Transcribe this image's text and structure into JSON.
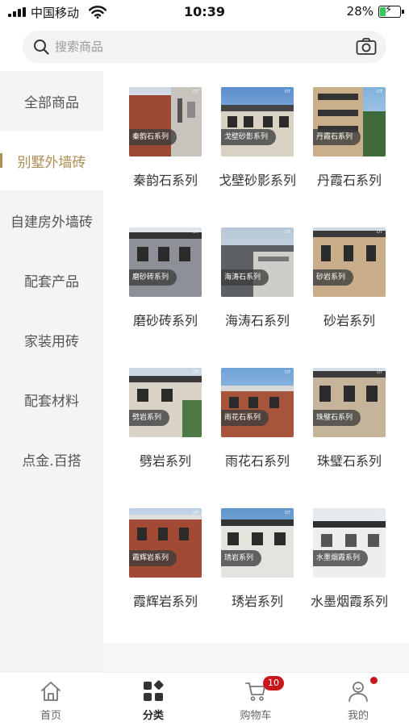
{
  "status_bar": {
    "carrier": "中国移动",
    "time": "10:39",
    "battery_percent": "28%",
    "battery_level": 0.28,
    "battery_color": "#34c759"
  },
  "search": {
    "placeholder": "搜索商品",
    "icon": "search-icon",
    "camera_icon": "camera-icon"
  },
  "sidebar": {
    "accent_color": "#b08d57",
    "items": [
      {
        "label": "全部商品",
        "active": false
      },
      {
        "label": "别墅外墙砖",
        "active": true
      },
      {
        "label": "自建房外墙砖",
        "active": false
      },
      {
        "label": "配套产品",
        "active": false
      },
      {
        "label": "家装用砖",
        "active": false
      },
      {
        "label": "配套材料",
        "active": false
      },
      {
        "label": "点金.百搭",
        "active": false
      }
    ]
  },
  "products": [
    {
      "name": "秦韵石系列",
      "tag": "秦韵石系列"
    },
    {
      "name": "戈壁砂影系列",
      "tag": "戈壁砂影系列"
    },
    {
      "name": "丹霞石系列",
      "tag": "丹霞石系列"
    },
    {
      "name": "磨砂砖系列",
      "tag": "磨砂砖系列"
    },
    {
      "name": "海涛石系列",
      "tag": "海涛石系列"
    },
    {
      "name": "砂岩系列",
      "tag": "砂岩系列"
    },
    {
      "name": "劈岩系列",
      "tag": "劈岩系列"
    },
    {
      "name": "雨花石系列",
      "tag": "雨花石系列"
    },
    {
      "name": "珠璧石系列",
      "tag": "珠璧石系列"
    },
    {
      "name": "霞辉岩系列",
      "tag": "霞辉岩系列"
    },
    {
      "name": "琇岩系列",
      "tag": "琇岩系列"
    },
    {
      "name": "水墨烟霞系列",
      "tag": "水墨烟霞系列"
    }
  ],
  "tab_bar": {
    "badge_color": "#c8161d",
    "tabs": [
      {
        "label": "首页",
        "icon": "home-icon",
        "active": false
      },
      {
        "label": "分类",
        "icon": "category-icon",
        "active": true
      },
      {
        "label": "购物车",
        "icon": "cart-icon",
        "active": false,
        "badge": "10"
      },
      {
        "label": "我的",
        "icon": "profile-icon",
        "active": false,
        "dot": true
      }
    ]
  }
}
